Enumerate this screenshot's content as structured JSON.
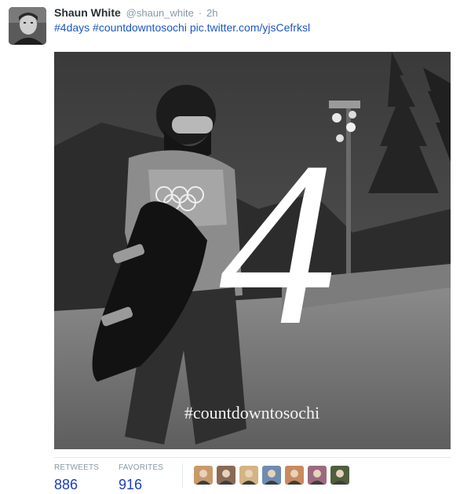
{
  "tweet": {
    "author_name": "Shaun White",
    "author_handle": "@shaun_white",
    "separator": "·",
    "time": "2h",
    "hashtag_1": "#4days",
    "hashtag_2": "#countdowntosochi",
    "media_link": "pic.twitter.com/yjsCefrksl"
  },
  "media": {
    "overlay_numeral": "4",
    "overlay_hashtag": "#countdowntosochi"
  },
  "stats": {
    "retweets_label": "RETWEETS",
    "retweets_value": "886",
    "favorites_label": "FAVORITES",
    "favorites_value": "916"
  },
  "facepile": [
    {
      "name": "favoriter-avatar-1",
      "color": "#c89a6a"
    },
    {
      "name": "favoriter-avatar-2",
      "color": "#8a6a52"
    },
    {
      "name": "favoriter-avatar-3",
      "color": "#d4b483"
    },
    {
      "name": "favoriter-avatar-4",
      "color": "#6e8cae"
    },
    {
      "name": "favoriter-avatar-5",
      "color": "#c98a5e"
    },
    {
      "name": "favoriter-avatar-6",
      "color": "#9c6a7e"
    },
    {
      "name": "favoriter-avatar-7",
      "color": "#4f5e3c"
    }
  ],
  "colors": {
    "link": "#1b57c4",
    "count": "#1b3cc4",
    "muted": "#8899a6"
  }
}
